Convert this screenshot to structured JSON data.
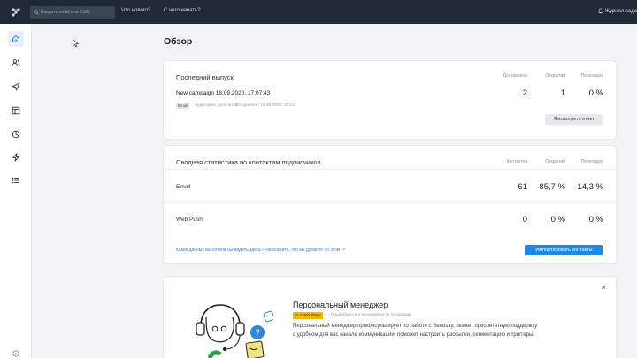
{
  "topbar": {
    "search_placeholder": "Введите email или CSID",
    "link_whats_new": "Что нового?",
    "link_start": "С чего начать?",
    "journal_label": "Журнал зада"
  },
  "page": {
    "title": "Обзор"
  },
  "last_issue": {
    "title": "Последний выпуск",
    "col_delivered": "Доставлено",
    "col_opened": "Открытий",
    "col_clicks": "Переходов",
    "campaign_name": "New campaign 16.09.2020, 17:07:43",
    "badge": "Email",
    "audience": "Аудитория: Для чатов",
    "sent": "Отправлен: 16.09.2020, 17:13",
    "delivered": "2",
    "opened": "1",
    "clicks": "0 %",
    "report_button": "Посмотреть отчет"
  },
  "summary": {
    "title": "Сводная статистика по контактам подписчиков",
    "col_contacts": "Контактов",
    "col_opened": "Открытий",
    "col_clicks": "Переходов",
    "rows": [
      {
        "label": "Email",
        "contacts": "61",
        "opened": "85,7 %",
        "clicks": "14,3 %"
      },
      {
        "label": "Web Push",
        "contacts": "0",
        "opened": "0 %",
        "clicks": "0 %"
      }
    ],
    "feedback_link": "Каких данных вы хотели бы видеть здесь? Расскажите, что вы думаете об этом ↗",
    "import_button": "Импортировать контакты"
  },
  "manager": {
    "title": "Персональный менеджер",
    "price": "от 2 000 ₽/мес",
    "more": "Подробности у менеджера по продажам",
    "text": "Персональный менеджер проконсультирует по работе с Sendsay, окажет приоритетную поддержку с удобном для вас канале коммуникации, поможет настроить рассылки, сегментацию и триггеры.",
    "close": "×"
  },
  "sidebar": {
    "items": [
      "home-icon",
      "contacts-icon",
      "send-icon",
      "templates-icon",
      "stats-icon",
      "automation-icon",
      "list-icon",
      "help-icon"
    ]
  },
  "colors": {
    "topbar": "#1f2a36",
    "accent": "#1e88e5",
    "badge_yellow": "#f7b500"
  }
}
